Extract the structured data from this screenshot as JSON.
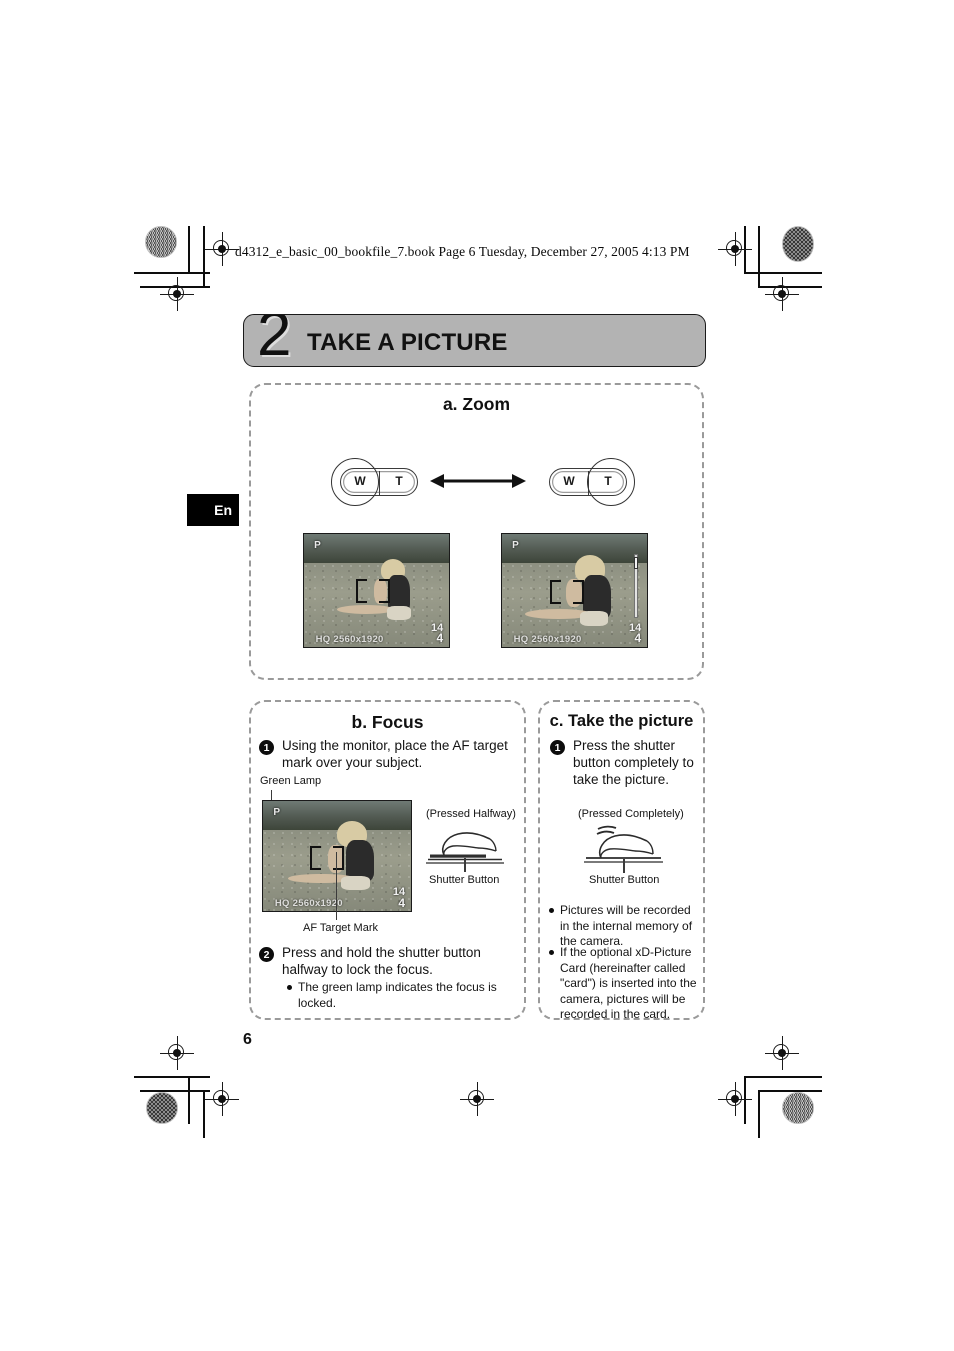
{
  "document": {
    "file_header": "d4312_e_basic_00_bookfile_7.book  Page 6  Tuesday, December 27, 2005  4:13 PM",
    "language_tab": "En",
    "page_number": "6"
  },
  "banner": {
    "number": "2",
    "title": "TAKE A PICTURE",
    "background_color": "#b3b3b3",
    "border_color": "#1a1a1a"
  },
  "sections": {
    "zoom": {
      "heading": "a. Zoom",
      "wide_button": {
        "left_label": "W",
        "right_label": "T",
        "highlighted": "W"
      },
      "tele_button": {
        "left_label": "W",
        "right_label": "T",
        "highlighted": "T"
      },
      "lcd_wide": {
        "mode": "P",
        "resolution": "HQ  2560x1920",
        "frames_remaining": "4",
        "card_indicator": "14"
      },
      "lcd_tele": {
        "mode": "P",
        "resolution": "HQ  2560x1920",
        "frames_remaining": "4",
        "card_indicator": "14"
      }
    },
    "focus": {
      "heading": "b. Focus",
      "step1_number": "1",
      "step1_text": "Using the monitor, place the AF target mark over your subject.",
      "label_green_lamp": "Green Lamp",
      "label_af_target": "AF Target Mark",
      "label_pressed_halfway": "(Pressed Halfway)",
      "label_shutter_button": "Shutter Button",
      "step2_number": "2",
      "step2_text": "Press and hold the shutter button halfway to lock the focus.",
      "step2_bullet": "The green lamp indicates the focus is locked.",
      "lcd": {
        "mode": "P",
        "resolution": "HQ  2560x1920",
        "frames_remaining": "4",
        "card_indicator": "14"
      }
    },
    "take_picture": {
      "heading": "c. Take the picture",
      "step1_number": "1",
      "step1_text": "Press the shutter button completely to take the picture.",
      "label_pressed_completely": "(Pressed Completely)",
      "label_shutter_button": "Shutter Button",
      "bullets": [
        "Pictures will be recorded in the internal memory of the camera.",
        "If the optional xD-Picture Card (hereinafter called \"card\") is inserted into the camera, pictures will be recorded in the card."
      ]
    }
  }
}
